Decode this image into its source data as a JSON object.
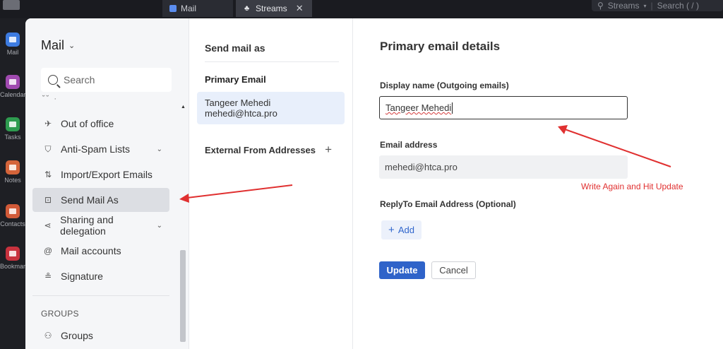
{
  "tabs": [
    {
      "label": "Mail",
      "icon": "mail-icon"
    },
    {
      "label": "Streams",
      "icon": "streams-icon",
      "close": "✕"
    }
  ],
  "top_search": {
    "scope": "Streams",
    "placeholder": "Search ( / )"
  },
  "rail": [
    {
      "label": "Mail",
      "color": "#3d7be0"
    },
    {
      "label": "Calendar",
      "color": "#a04ab0"
    },
    {
      "label": "Tasks",
      "color": "#2e9b4f"
    },
    {
      "label": "Notes",
      "color": "#d4643a"
    },
    {
      "label": "Contacts",
      "color": "#d15a38"
    },
    {
      "label": "Bookmarks",
      "color": "#c8323e"
    }
  ],
  "nav": {
    "title": "Mail",
    "search_placeholder": "Search",
    "items": [
      {
        "label": "Out of office",
        "icon": "plane-icon"
      },
      {
        "label": "Anti-Spam Lists",
        "icon": "shield-icon"
      },
      {
        "label": "Import/Export Emails",
        "icon": "arrows-icon"
      },
      {
        "label": "Send Mail As",
        "icon": "mail-as-icon"
      },
      {
        "label": "Sharing and delegation",
        "icon": "share-icon"
      },
      {
        "label": "Mail accounts",
        "icon": "at-icon"
      },
      {
        "label": "Signature",
        "icon": "signature-icon"
      }
    ],
    "groups_header": "GROUPS",
    "groups_item": "Groups"
  },
  "middle": {
    "title": "Send mail as",
    "primary_label": "Primary Email",
    "primary_name": "Tangeer Mehedi",
    "primary_email": "mehedi@htca.pro",
    "external_label": "External From Addresses"
  },
  "details": {
    "title": "Primary email details",
    "display_name_label": "Display name (Outgoing emails)",
    "display_name_value": "Tangeer Mehedi",
    "email_label": "Email address",
    "email_value": "mehedi@htca.pro",
    "replyto_label": "ReplyTo Email Address (Optional)",
    "add_label": "Add",
    "update_label": "Update",
    "cancel_label": "Cancel"
  },
  "annotation": {
    "text": "Write Again and Hit Update",
    "color": "#e03030"
  }
}
